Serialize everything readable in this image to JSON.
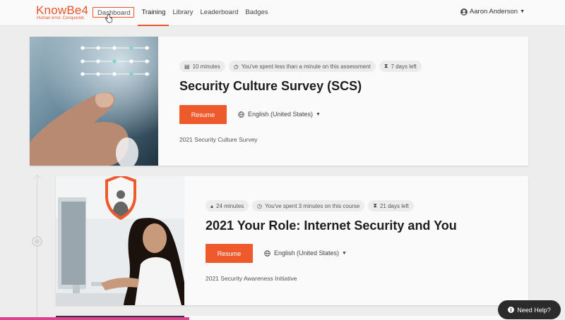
{
  "brand": {
    "name": "KnowBe4",
    "tagline": "Human error. Conquered.",
    "accent": "#e8562a"
  },
  "nav": {
    "items": [
      {
        "label": "Dashboard"
      },
      {
        "label": "Training"
      },
      {
        "label": "Library"
      },
      {
        "label": "Leaderboard"
      },
      {
        "label": "Badges"
      }
    ],
    "active": "Training"
  },
  "user": {
    "name": "Aaron Anderson"
  },
  "cards": [
    {
      "duration": "10 minutes",
      "time_spent": "You've spent less than a minute on this assessment",
      "days_left": "7 days left",
      "title": "Security Culture Survey (SCS)",
      "button": "Resume",
      "language": "English (United States)",
      "campaign": "2021 Security Culture Survey"
    },
    {
      "duration": "24 minutes",
      "time_spent": "You've spent 3 minutes on this course",
      "days_left": "21 days left",
      "title": "2021 Your Role: Internet Security and You",
      "button": "Resume",
      "language": "English (United States)",
      "campaign": "2021 Security Awareness Initiative"
    }
  ],
  "help": {
    "label": "Need Help?"
  },
  "colors": {
    "button": "#ee5a2c",
    "help_bg": "#2b2b2b",
    "page_bg": "#ededed"
  }
}
